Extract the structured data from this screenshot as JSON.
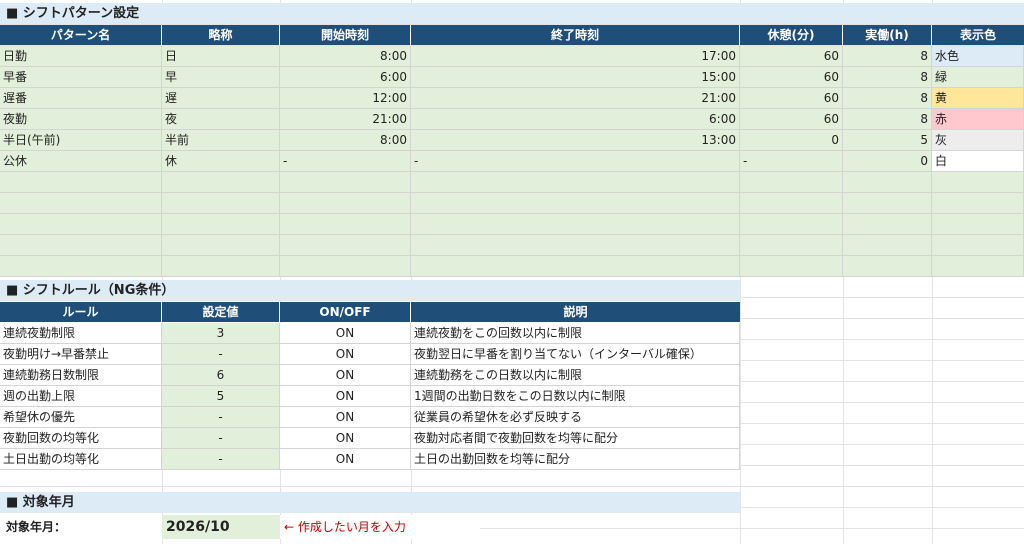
{
  "pattern_section": {
    "title": "■ シフトパターン設定",
    "headers": [
      "パターン名",
      "略称",
      "開始時刻",
      "終了時刻",
      "休憩(分)",
      "実働(h)",
      "表示色"
    ],
    "rows": [
      {
        "name": "日勤",
        "abbr": "日",
        "start": "8:00",
        "end": "17:00",
        "break": "60",
        "work": "8",
        "color": "水色",
        "swatch": "#ddebf7"
      },
      {
        "name": "早番",
        "abbr": "早",
        "start": "6:00",
        "end": "15:00",
        "break": "60",
        "work": "8",
        "color": "緑",
        "swatch": "#e2efda"
      },
      {
        "name": "遅番",
        "abbr": "遅",
        "start": "12:00",
        "end": "21:00",
        "break": "60",
        "work": "8",
        "color": "黄",
        "swatch": "#ffe699"
      },
      {
        "name": "夜勤",
        "abbr": "夜",
        "start": "21:00",
        "end": "6:00",
        "break": "60",
        "work": "8",
        "color": "赤",
        "swatch": "#ffc7ce"
      },
      {
        "name": "半日(午前)",
        "abbr": "半前",
        "start": "8:00",
        "end": "13:00",
        "break": "0",
        "work": "5",
        "color": "灰",
        "swatch": "#ededed"
      },
      {
        "name": "公休",
        "abbr": "休",
        "start": "-",
        "end": "-",
        "break": "-",
        "work": "0",
        "color": "白",
        "swatch": "#ffffff"
      }
    ]
  },
  "rule_section": {
    "title": "■ シフトルール（NG条件）",
    "headers": [
      "ルール",
      "設定値",
      "ON/OFF",
      "説明"
    ],
    "rows": [
      {
        "rule": "連続夜勤制限",
        "value": "3",
        "onoff": "ON",
        "desc": "連続夜勤をこの回数以内に制限"
      },
      {
        "rule": "夜勤明け→早番禁止",
        "value": "-",
        "onoff": "ON",
        "desc": "夜勤翌日に早番を割り当てない（インターバル確保）"
      },
      {
        "rule": "連続勤務日数制限",
        "value": "6",
        "onoff": "ON",
        "desc": "連続勤務をこの日数以内に制限"
      },
      {
        "rule": "週の出勤上限",
        "value": "5",
        "onoff": "ON",
        "desc": "1週間の出勤日数をこの日数以内に制限"
      },
      {
        "rule": "希望休の優先",
        "value": "-",
        "onoff": "ON",
        "desc": "従業員の希望休を必ず反映する"
      },
      {
        "rule": "夜勤回数の均等化",
        "value": "-",
        "onoff": "ON",
        "desc": "夜勤対応者間で夜勤回数を均等に配分"
      },
      {
        "rule": "土日出勤の均等化",
        "value": "-",
        "onoff": "ON",
        "desc": "土日の出勤回数を均等に配分"
      }
    ]
  },
  "month_section": {
    "title": "■ 対象年月",
    "label": "対象年月：",
    "value": "2026/10",
    "hint": "← 作成したい月を入力"
  }
}
